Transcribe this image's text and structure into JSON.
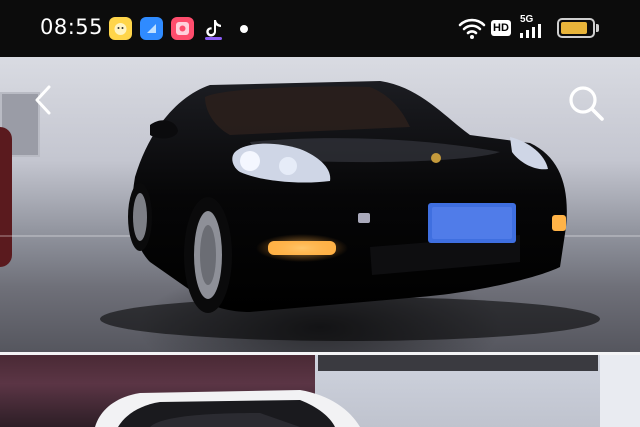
{
  "status_bar": {
    "time": "08:55",
    "network_label": "5G",
    "hd_label": "HD",
    "battery_level": 0.85,
    "icons": [
      "app-icon",
      "app-icon",
      "app-icon",
      "tiktok-icon",
      "notification-dot",
      "wifi-icon",
      "signal-icon",
      "battery-icon"
    ]
  },
  "header": {
    "back_icon": "chevron-left-icon",
    "search_icon": "search-icon"
  },
  "colors": {
    "status_bar_bg": "#0c0c0c",
    "battery": "#e8b43a",
    "headlight": "#ffb347",
    "plate": "#3f6fe0"
  }
}
